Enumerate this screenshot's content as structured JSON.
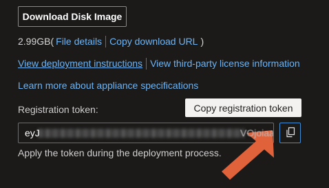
{
  "download_button": {
    "label": "Download Disk Image"
  },
  "info_row": {
    "size": "2.99GB(",
    "file_details": "File details",
    "copy_download_url": "Copy download URL",
    "closing": ")"
  },
  "links_row": {
    "deployment_instructions": "View deployment instructions",
    "third_party_license": "View third-party license information"
  },
  "appliance_specs": "Learn more about appliance specifications",
  "registration": {
    "label": "Registration token:",
    "token_start": "eyJ",
    "token_end": "VOjoiaavar",
    "helper": "Apply the token during the deployment process."
  },
  "tooltip": {
    "text": "Copy registration token"
  },
  "colors": {
    "background": "#1b1a19",
    "link": "#6cb4f5",
    "accent_border": "#3f8fd8",
    "arrow": "#e0623b"
  },
  "icons": {
    "copy": "copy-icon",
    "arrow": "callout-arrow-icon"
  }
}
